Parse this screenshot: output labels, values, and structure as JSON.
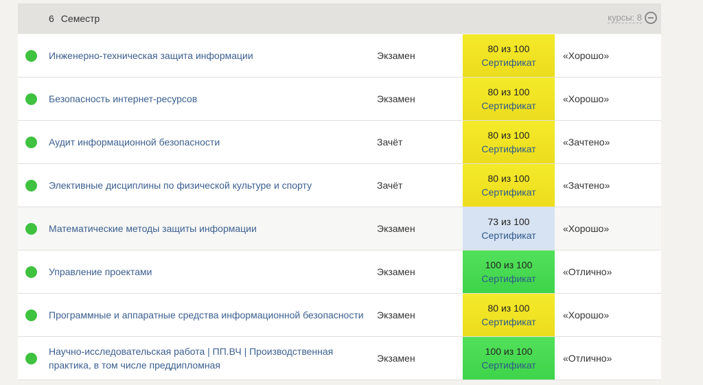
{
  "semester": {
    "number": "6",
    "title": "Семестр",
    "courses_count_label": "курсы: 8"
  },
  "colors": {
    "status_dot": "#3fc23f",
    "score_yellow": "#f2e627",
    "score_blue": "#d7e2f2",
    "score_green": "#4ada52",
    "link": "#3b5f8f"
  },
  "icons": {
    "collapse": "collapse-icon",
    "status": "status-dot"
  },
  "courses": [
    {
      "name": "Инженерно-техническая защита информации",
      "type": "Экзамен",
      "score": "80 из 100",
      "cert": "Сертификат",
      "grade": "«Хорошо»",
      "color": "yellow"
    },
    {
      "name": "Безопасность интернет-ресурсов",
      "type": "Экзамен",
      "score": "80 из 100",
      "cert": "Сертификат",
      "grade": "«Хорошо»",
      "color": "yellow"
    },
    {
      "name": "Аудит информационной безопасности",
      "type": "Зачёт",
      "score": "80 из 100",
      "cert": "Сертификат",
      "grade": "«Зачтено»",
      "color": "yellow"
    },
    {
      "name": "Элективные дисциплины по физической культуре и спорту",
      "type": "Зачёт",
      "score": "80 из 100",
      "cert": "Сертификат",
      "grade": "«Зачтено»",
      "color": "yellow"
    },
    {
      "name": "Математические методы защиты информации",
      "type": "Экзамен",
      "score": "73 из 100",
      "cert": "Сертификат",
      "grade": "«Хорошо»",
      "color": "blue"
    },
    {
      "name": "Управление проектами",
      "type": "Экзамен",
      "score": "100 из 100",
      "cert": "Сертификат",
      "grade": "«Отлично»",
      "color": "green"
    },
    {
      "name": "Программные и аппаратные средства информационной безопасности",
      "type": "Экзамен",
      "score": "80 из 100",
      "cert": "Сертификат",
      "grade": "«Хорошо»",
      "color": "yellow"
    },
    {
      "name": "Научно-исследовательская работа | ПП.ВЧ | Производственная практика, в том числе преддипломная",
      "type": "Экзамен",
      "score": "100 из 100",
      "cert": "Сертификат",
      "grade": "«Отлично»",
      "color": "green"
    }
  ]
}
